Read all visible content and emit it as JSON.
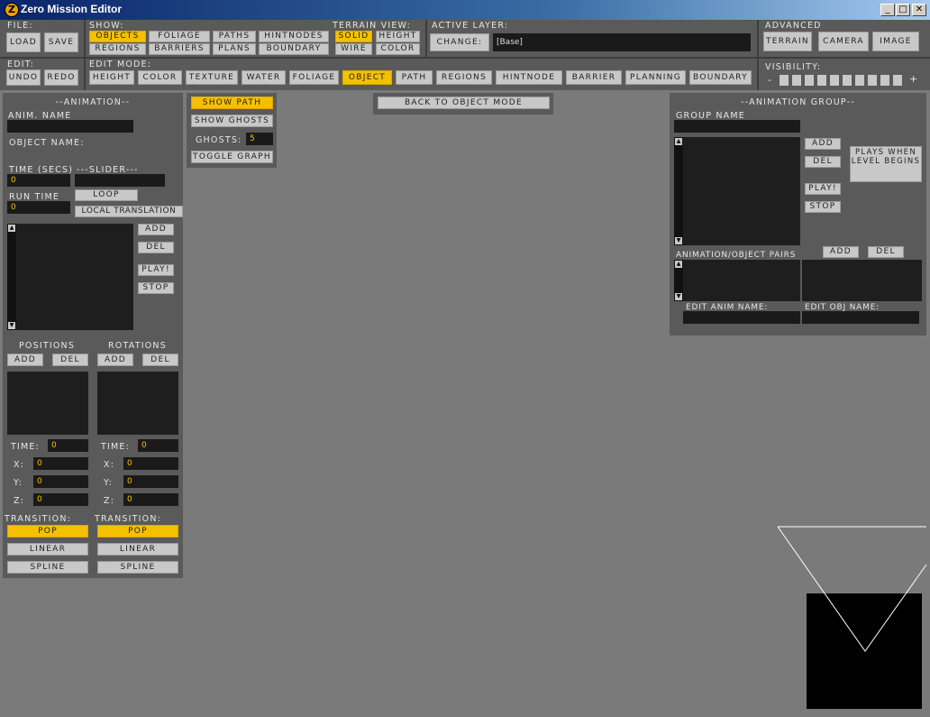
{
  "window": {
    "title": "Zero Mission Editor",
    "minimize": "_",
    "maximize": "□",
    "close": "✕"
  },
  "file": {
    "label": "File:",
    "load": "Load",
    "save": "Save"
  },
  "edit": {
    "label": "Edit:",
    "undo": "Undo",
    "redo": "Redo"
  },
  "show": {
    "label": "Show:",
    "objects": "Objects",
    "foliage": "Foliage",
    "paths": "Paths",
    "hintnodes": "HintNodes",
    "regions": "Regions",
    "barriers": "Barriers",
    "plans": "Plans",
    "boundary": "Boundary"
  },
  "terrain_view": {
    "label": "Terrain View:",
    "solid": "Solid",
    "height": "Height",
    "wire": "Wire",
    "color": "Color"
  },
  "active_layer": {
    "label": "Active Layer:",
    "change": "Change:",
    "value": "[Base]"
  },
  "advanced": {
    "label": "Advanced",
    "terrain": "Terrain",
    "camera": "Camera",
    "image": "Image"
  },
  "visibility": {
    "label": "Visibility:",
    "minus": "-",
    "plus": "+"
  },
  "edit_mode": {
    "label": "Edit Mode:",
    "height": "Height",
    "color": "Color",
    "texture": "Texture",
    "water": "Water",
    "foliage": "Foliage",
    "object": "Object",
    "path": "Path",
    "regions": "Regions",
    "hintnode": "HintNode",
    "barrier": "Barrier",
    "planning": "Planning",
    "boundary": "Boundary"
  },
  "animation": {
    "title": "--Animation--",
    "anim_name_label": "Anim. Name",
    "object_name_label": "Object Name:",
    "time_label": "Time (Secs)",
    "slider_label": "---Slider---",
    "time_value": "0",
    "run_time_label": "Run Time",
    "run_time_value": "0",
    "loop": "Loop",
    "local_translation": "Local Translation",
    "add": "Add",
    "del": "Del",
    "play": "Play!",
    "stop": "Stop",
    "positions_label": "Positions",
    "rotations_label": "Rotations",
    "pos_add": "Add",
    "pos_del": "Del",
    "rot_add": "Add",
    "rot_del": "Del",
    "pos_time_label": "Time:",
    "pos_time": "0",
    "pos_x_label": "X:",
    "pos_x": "0",
    "pos_y_label": "Y:",
    "pos_y": "0",
    "pos_z_label": "Z:",
    "pos_z": "0",
    "rot_time_label": "Time:",
    "rot_time": "0",
    "rot_x_label": "X:",
    "rot_x": "0",
    "rot_y_label": "Y:",
    "rot_y": "0",
    "rot_z_label": "Z:",
    "rot_z": "0",
    "pos_transition_label": "Transition:",
    "rot_transition_label": "Transition:",
    "pop": "Pop",
    "linear": "Linear",
    "spline": "Spline"
  },
  "path_tools": {
    "show_path": "Show Path",
    "show_ghosts": "Show Ghosts",
    "ghosts_label": "Ghosts:",
    "ghosts_value": "5",
    "toggle_graph": "Toggle Graph"
  },
  "back_to_object": "Back To Object Mode",
  "anim_group": {
    "title": "--Animation Group--",
    "group_name_label": "Group Name",
    "add": "Add",
    "del": "Del",
    "play": "Play!",
    "stop": "Stop",
    "plays_when": "Plays When Level Begins",
    "pairs_label": "Animation/Object Pairs",
    "pairs_add": "Add",
    "pairs_del": "Del",
    "edit_anim_name": "Edit Anim Name:",
    "edit_obj_name": "Edit Obj Name:"
  },
  "colors": {
    "accent": "#f5c000",
    "panel": "#5a5a5a",
    "viewport": "#7a7a7a",
    "button": "#c8c8c8"
  }
}
